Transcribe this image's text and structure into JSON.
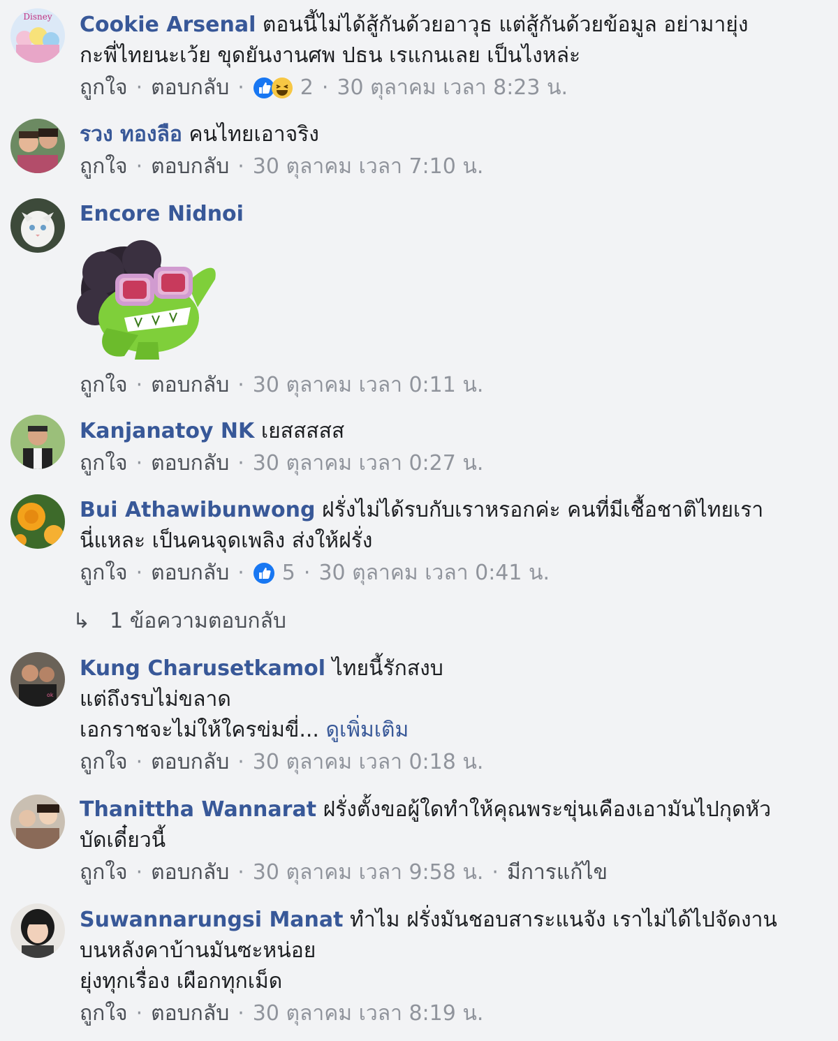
{
  "actions": {
    "like": "ถูกใจ",
    "reply": "ตอบกลับ",
    "dot": "·"
  },
  "colors": {
    "author": "#385898",
    "meta": "#90949c",
    "background": "#f2f3f5",
    "like_blue": "#1877f2"
  },
  "comments": [
    {
      "author": "Cookie Arsenal",
      "lines": [
        "ตอนนี้ไม่ได้สู้กันด้วยอาวุธ แต่สู้กันด้วยข้อมูล อย่ามายุ่ง",
        "กะพี่ไทยนะเว้ย ขุดยันงานศพ ปธน เรแกนเลย เป็นไงหล่ะ"
      ],
      "reactions_count": "2",
      "reaction_icons": [
        "like-icon",
        "haha-icon"
      ],
      "time": "30 ตุลาคม เวลา 8:23 น."
    },
    {
      "author": "รวง ทองลือ",
      "lines": [
        "คนไทยเอาจริง"
      ],
      "time": "30 ตุลาคม เวลา 7:10 น."
    },
    {
      "author": "Encore Nidnoi",
      "sticker": "om-nom-afro-sticker",
      "time": "30 ตุลาคม เวลา 0:11 น."
    },
    {
      "author": "Kanjanatoy NK",
      "lines": [
        "เยสสสสส"
      ],
      "time": "30 ตุลาคม เวลา 0:27 น."
    },
    {
      "author": "Bui Athawibunwong",
      "lines": [
        "ฝรั่งไม่ได้รบกับเราหรอกค่ะ คนที่มีเชื้อชาติไทยเรา",
        "นี่แหละ เป็นคนจุดเพลิง ส่งให้ฝรั่ง"
      ],
      "reactions_count": "5",
      "reaction_icons": [
        "like-icon"
      ],
      "time": "30 ตุลาคม เวลา 0:41 น.",
      "replies_label": "1 ข้อความตอบกลับ"
    },
    {
      "author": "Kung Charusetkamol",
      "lines": [
        "ไทยนี้รักสงบ",
        "แต่ถึงรบไม่ขลาด",
        "เอกราชจะไม่ให้ใครข่มขี่..."
      ],
      "see_more": "ดูเพิ่มเติม",
      "time": "30 ตุลาคม เวลา 0:18 น."
    },
    {
      "author": "Thanittha Wannarat",
      "lines": [
        "ฝรั่งตั้งขอผู้ใดทำให้คุณพระขุ่นเคืองเอามันไปกุดหัว",
        "บัดเดี๋ยวนี้"
      ],
      "time": "30 ตุลาคม เวลา 9:58 น.",
      "edited": "มีการแก้ไข"
    },
    {
      "author": "Suwannarungsi Manat",
      "lines": [
        "ทำไม ฝรั่งมันชอบสาระแนจัง เราไม่ได้ไปจัดงาน",
        "บนหลังคาบ้านมันซะหน่อย",
        "ยุ่งทุกเรื่อง เผือกทุกเม็ด"
      ],
      "time": "30 ตุลาคม เวลา 8:19 น."
    }
  ]
}
